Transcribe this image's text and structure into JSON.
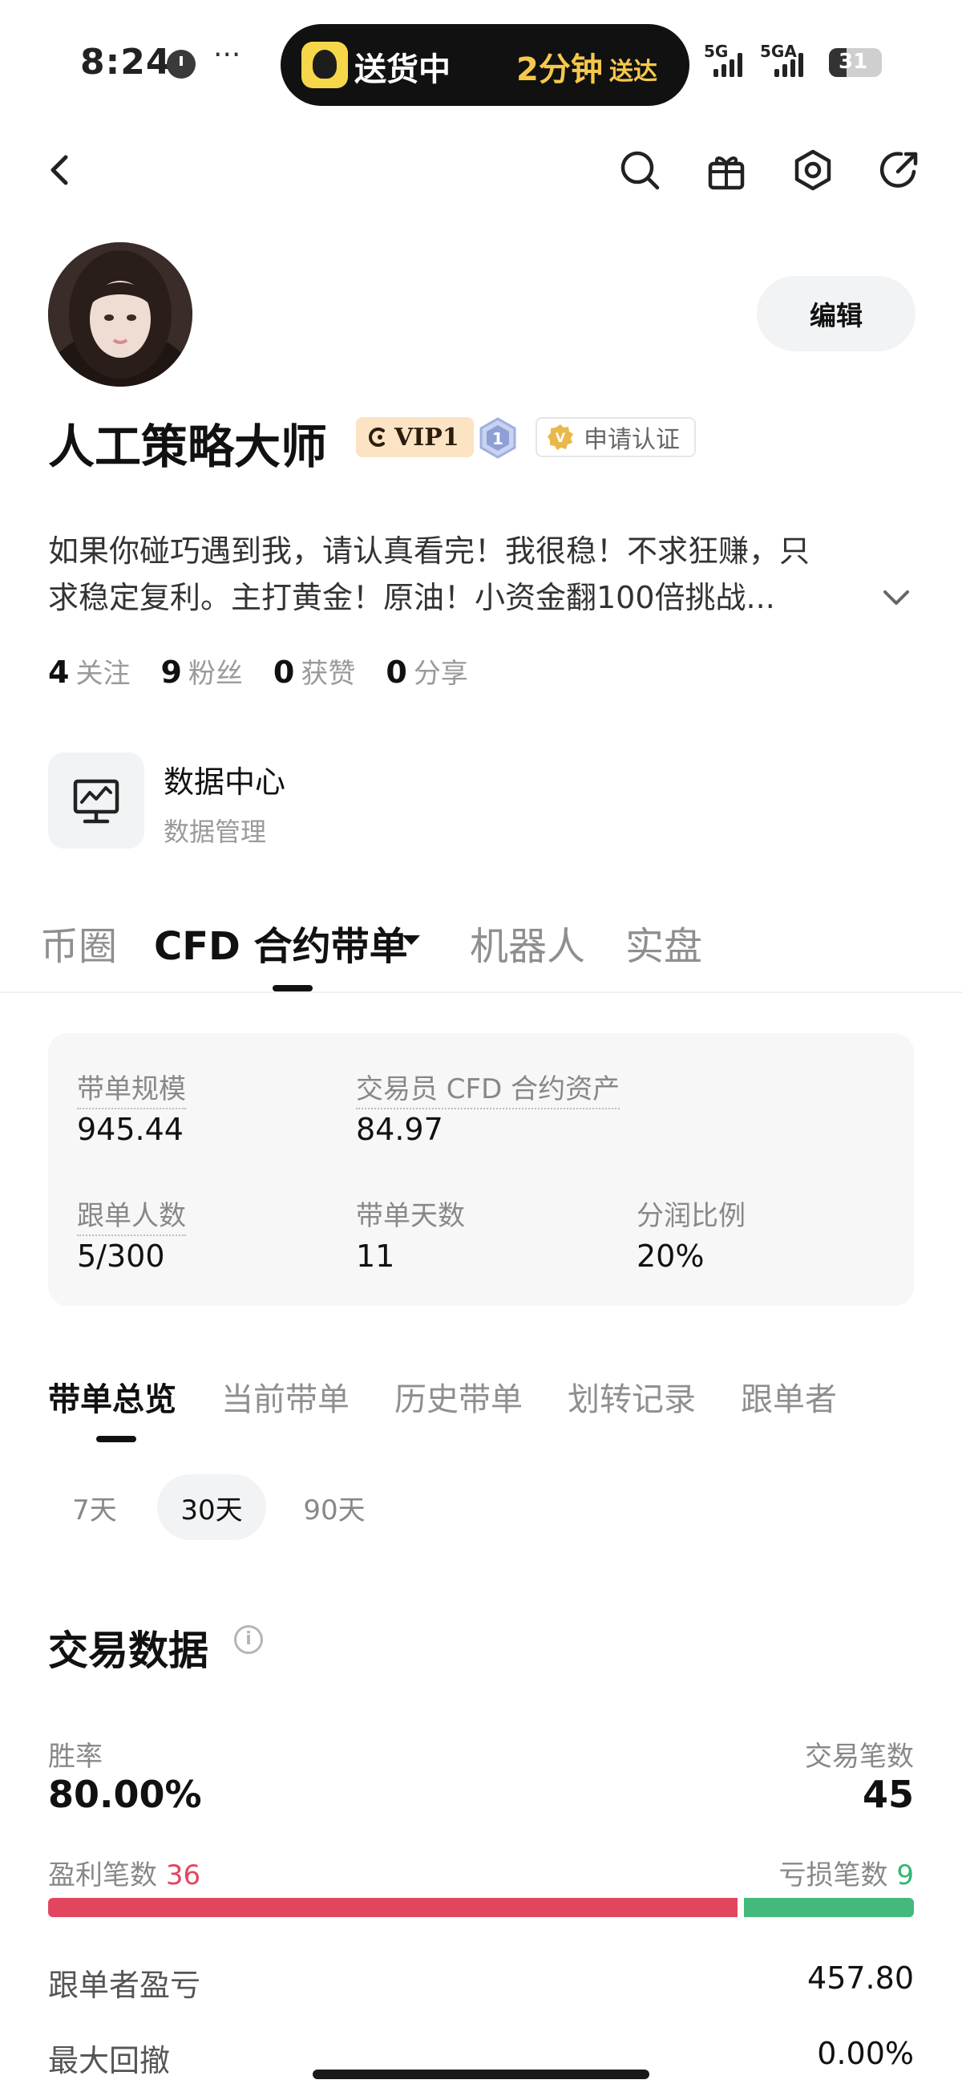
{
  "status_bar": {
    "time": "8:24",
    "dots": "···",
    "island_title": "送货中",
    "island_eta": "2分钟",
    "island_eta_suffix": "送达",
    "signal1_label": "5G",
    "signal2_label": "5GA",
    "battery": "31"
  },
  "nav": {
    "icons": [
      "back-icon",
      "search-icon",
      "gift-icon",
      "settings-icon",
      "share-icon"
    ]
  },
  "profile": {
    "edit_label": "编辑",
    "name": "人工策略大师",
    "vip_label": "VIP1",
    "level_number": "1",
    "verify_label": "申请认证",
    "bio_line1": "如果你碰巧遇到我，请认真看完！我很稳！不求狂赚，只",
    "bio_line2": "求稳定复利。主打黄金！原油！小资金翻100倍挑战...",
    "stats": [
      {
        "num": "4",
        "label": "关注"
      },
      {
        "num": "9",
        "label": "粉丝"
      },
      {
        "num": "0",
        "label": "获赞"
      },
      {
        "num": "0",
        "label": "分享"
      }
    ],
    "data_center_title": "数据中心",
    "data_center_sub": "数据管理"
  },
  "main_tabs": [
    {
      "label": "币圈"
    },
    {
      "label": "CFD 合约带单"
    },
    {
      "label": "机器人"
    },
    {
      "label": "实盘"
    }
  ],
  "summary": {
    "scale_label": "带单规模",
    "scale_value": "945.44",
    "assets_label": "交易员 CFD 合约资产",
    "assets_value": "84.97",
    "followers_label": "跟单人数",
    "followers_value": "5/300",
    "days_label": "带单天数",
    "days_value": "11",
    "share_label": "分润比例",
    "share_value": "20%"
  },
  "sub_tabs": [
    {
      "label": "带单总览"
    },
    {
      "label": "当前带单"
    },
    {
      "label": "历史带单"
    },
    {
      "label": "划转记录"
    },
    {
      "label": "跟单者"
    }
  ],
  "periods": [
    {
      "label": "7天"
    },
    {
      "label": "30天"
    },
    {
      "label": "90天"
    }
  ],
  "trade_data": {
    "title": "交易数据",
    "info": "i",
    "win_rate_label": "胜率",
    "win_rate": "80.00%",
    "trades_label": "交易笔数",
    "trades": "45",
    "profit_label": "盈利笔数",
    "profit_count": "36",
    "loss_label": "亏损笔数",
    "loss_count": "9",
    "profit_fraction": 0.8,
    "follower_pnl_label": "跟单者盈亏",
    "follower_pnl": "457.80",
    "max_drawdown_label": "最大回撤",
    "max_drawdown": "0.00%"
  },
  "colors": {
    "profit": "#e2465f",
    "loss": "#2fb672",
    "vip_bg": "#fbe3c4"
  }
}
